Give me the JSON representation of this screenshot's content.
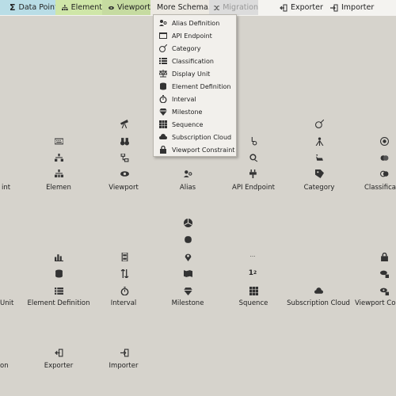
{
  "toolbar": {
    "data_point": "Data Point",
    "element": "Element",
    "viewport": "Viewport",
    "more_schema": "More Schema...",
    "migration": "Migration",
    "exporter": "Exporter",
    "importer": "Importer",
    "colors": {
      "data_point_bg": "#b9dde6",
      "element_bg": "#cfe6a8",
      "viewport_bg": "#c6dba1",
      "more_schema_bg": "#ece9e2",
      "migration_bg": "#dcdcdc"
    }
  },
  "menu": {
    "items": [
      {
        "label": "Alias Definition",
        "icon": "users-icon"
      },
      {
        "label": "API Endpoint",
        "icon": "window-icon"
      },
      {
        "label": "Category",
        "icon": "category-icon"
      },
      {
        "label": "Classification",
        "icon": "list-icon"
      },
      {
        "label": "Display Unit",
        "icon": "scale-icon"
      },
      {
        "label": "Element Definition",
        "icon": "database-icon"
      },
      {
        "label": "Interval",
        "icon": "stopwatch-icon"
      },
      {
        "label": "Milestone",
        "icon": "diamond-icon"
      },
      {
        "label": "Sequence",
        "icon": "grid-icon"
      },
      {
        "label": "Subscription Cloud",
        "icon": "cloud-icon"
      },
      {
        "label": "Viewport Constraint",
        "icon": "lock-icon"
      }
    ]
  },
  "canvas": {
    "row1_labels": [
      "int",
      "Elemen",
      "Viewport",
      "Alias",
      "API Endpoint",
      "Category",
      "Classificatio"
    ],
    "row2_labels": [
      "Unit",
      "Element Definition",
      "Interval",
      "Milestone",
      "Squence",
      "Subscription Cloud",
      "Viewport Cons"
    ],
    "row3_labels": [
      "on",
      "Exporter",
      "Importer"
    ]
  }
}
